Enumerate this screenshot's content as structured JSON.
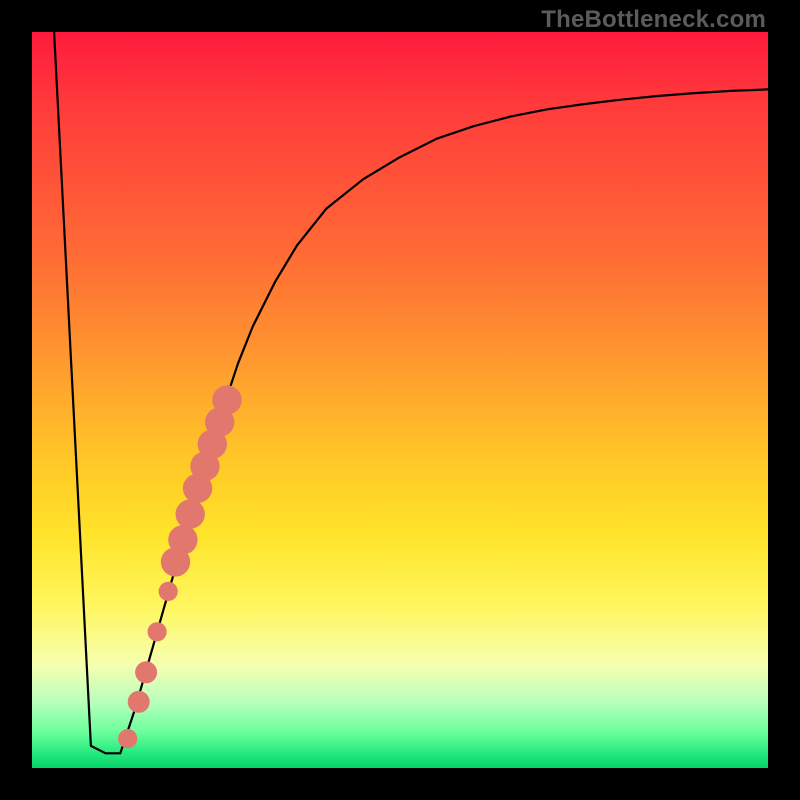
{
  "watermark": "TheBottleneck.com",
  "colors": {
    "frame": "#000000",
    "curve": "#000000",
    "marker_fill": "#e2786d",
    "marker_stroke": "#c85b50",
    "watermark_text": "#5b5b5b"
  },
  "chart_data": {
    "type": "line",
    "title": "",
    "xlabel": "",
    "ylabel": "",
    "xlim": [
      0,
      100
    ],
    "ylim": [
      0,
      100
    ],
    "grid": false,
    "series": [
      {
        "name": "bottleneck-curve",
        "comment": "V-shaped curve: steep linear drop to near zero, short flat, then asymptotic rise toward ~92. Values estimated from pixel positions.",
        "x": [
          3,
          8,
          10,
          12,
          14,
          16,
          18,
          20,
          22,
          24,
          26,
          28,
          30,
          33,
          36,
          40,
          45,
          50,
          55,
          60,
          65,
          70,
          75,
          80,
          85,
          90,
          95,
          100
        ],
        "values": [
          100,
          3,
          2,
          2,
          8,
          15,
          22,
          29,
          36,
          43,
          49,
          55,
          60,
          66,
          71,
          76,
          80,
          83,
          85.5,
          87.2,
          88.5,
          89.5,
          90.2,
          90.8,
          91.3,
          91.7,
          92.0,
          92.2
        ]
      }
    ],
    "markers": {
      "name": "highlighted-points",
      "comment": "Salmon dots along the early rising limb; radius in chart-units.",
      "points": [
        {
          "x": 13.0,
          "y": 4.0,
          "r": 1.3
        },
        {
          "x": 14.5,
          "y": 9.0,
          "r": 1.5
        },
        {
          "x": 15.5,
          "y": 13.0,
          "r": 1.5
        },
        {
          "x": 17.0,
          "y": 18.5,
          "r": 1.3
        },
        {
          "x": 18.5,
          "y": 24.0,
          "r": 1.3
        },
        {
          "x": 19.5,
          "y": 28.0,
          "r": 2.0
        },
        {
          "x": 20.5,
          "y": 31.0,
          "r": 2.0
        },
        {
          "x": 21.5,
          "y": 34.5,
          "r": 2.0
        },
        {
          "x": 22.5,
          "y": 38.0,
          "r": 2.0
        },
        {
          "x": 23.5,
          "y": 41.0,
          "r": 2.0
        },
        {
          "x": 24.5,
          "y": 44.0,
          "r": 2.0
        },
        {
          "x": 25.5,
          "y": 47.0,
          "r": 2.0
        },
        {
          "x": 26.5,
          "y": 50.0,
          "r": 2.0
        }
      ]
    }
  }
}
